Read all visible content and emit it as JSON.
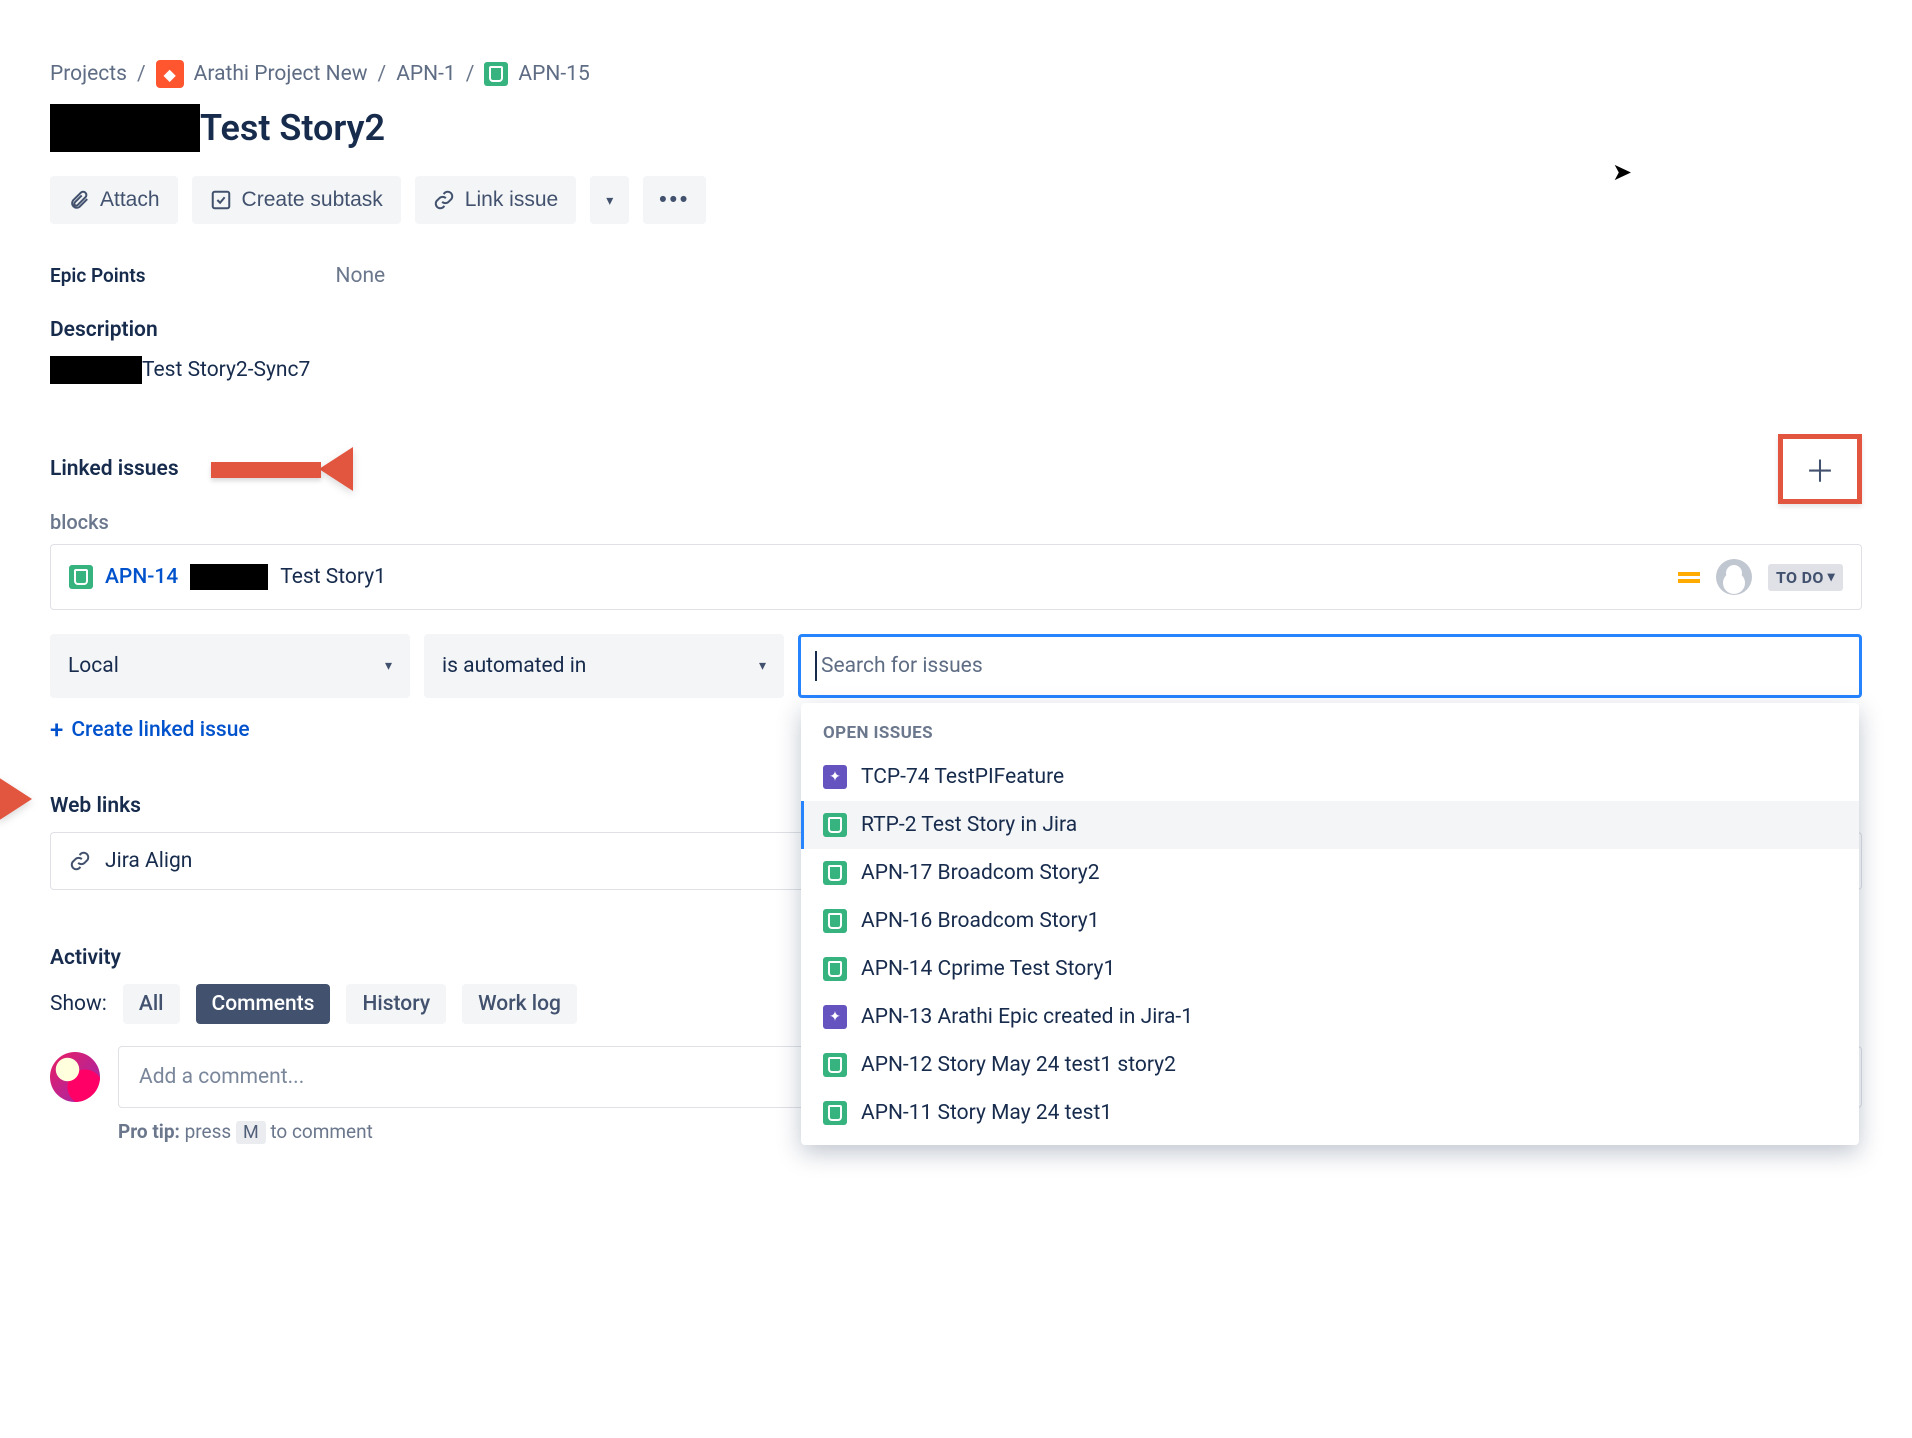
{
  "breadcrumbs": {
    "projects": "Projects",
    "project_name": "Arathi Project New",
    "parent_key": "APN-1",
    "issue_key": "APN-15"
  },
  "title": "Test Story2",
  "toolbar": {
    "attach": "Attach",
    "create_subtask": "Create subtask",
    "link_issue": "Link issue"
  },
  "fields": {
    "epic_points_label": "Epic Points",
    "epic_points_value": "None",
    "description_label": "Description",
    "description_value": "Test Story2-Sync7"
  },
  "linked": {
    "header": "Linked issues",
    "relation": "blocks",
    "item": {
      "key": "APN-14",
      "summary_suffix": "Test Story1",
      "status": "TO DO"
    }
  },
  "link_form": {
    "scope": "Local",
    "relation": "is automated in",
    "search_placeholder": "Search for issues",
    "create_linked": "Create linked issue",
    "dropdown": {
      "group": "OPEN ISSUES",
      "items": [
        {
          "type": "epic",
          "text": "TCP-74 TestPIFeature"
        },
        {
          "type": "story",
          "text": "RTP-2 Test Story in Jira",
          "hover": true
        },
        {
          "type": "story",
          "text": "APN-17 Broadcom Story2"
        },
        {
          "type": "story",
          "text": "APN-16 Broadcom Story1"
        },
        {
          "type": "story",
          "text": "APN-14 Cprime Test Story1"
        },
        {
          "type": "epic",
          "text": "APN-13 Arathi Epic created in Jira-1"
        },
        {
          "type": "story",
          "text": "APN-12 Story May 24 test1 story2"
        },
        {
          "type": "story",
          "text": "APN-11 Story May 24 test1"
        }
      ]
    }
  },
  "web_links": {
    "header": "Web links",
    "item": "Jira Align"
  },
  "activity": {
    "header": "Activity",
    "show": "Show:",
    "tabs": {
      "all": "All",
      "comments": "Comments",
      "history": "History",
      "worklog": "Work log"
    },
    "comment_placeholder": "Add a comment...",
    "pro_tip_pre": "Pro tip:",
    "pro_tip_mid": "press",
    "pro_tip_key": "M",
    "pro_tip_post": "to comment"
  }
}
